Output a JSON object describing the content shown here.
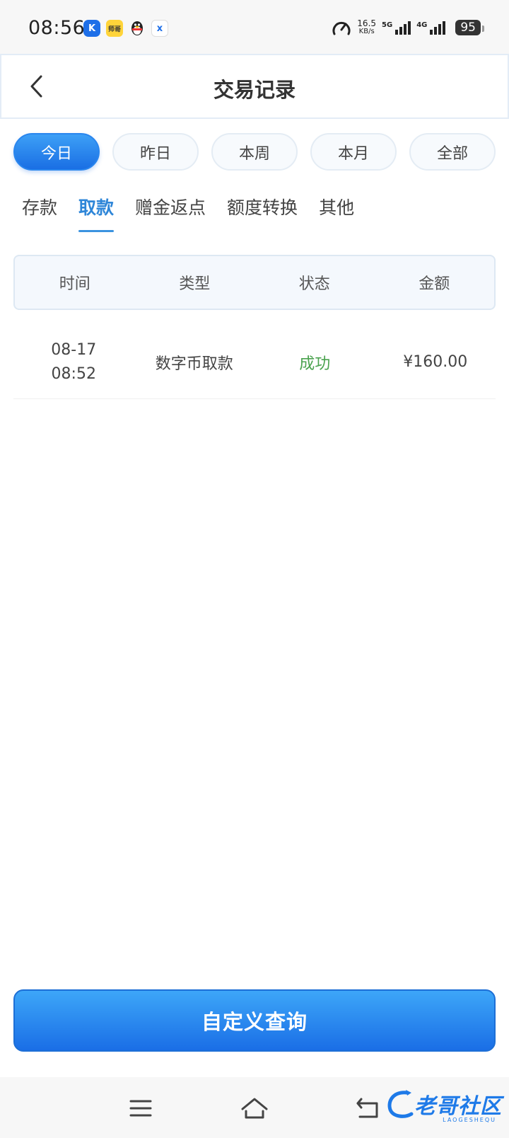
{
  "status_bar": {
    "time": "08:56",
    "apps": [
      {
        "name": "k-app-icon",
        "glyph": "K"
      },
      {
        "name": "yellow-app-icon",
        "glyph": "师哥"
      },
      {
        "name": "qq-icon",
        "glyph": ""
      },
      {
        "name": "x-app-icon",
        "glyph": "x"
      }
    ],
    "speed_value": "16.5",
    "speed_unit": "KB/s",
    "net1": "5G",
    "net2": "4G",
    "battery": "95"
  },
  "header": {
    "title": "交易记录",
    "back_icon": "chevron-left-icon"
  },
  "periods": [
    {
      "label": "今日",
      "active": true
    },
    {
      "label": "昨日",
      "active": false
    },
    {
      "label": "本周",
      "active": false
    },
    {
      "label": "本月",
      "active": false
    },
    {
      "label": "全部",
      "active": false
    }
  ],
  "tabs": [
    {
      "label": "存款",
      "active": false
    },
    {
      "label": "取款",
      "active": true
    },
    {
      "label": "赠金返点",
      "active": false
    },
    {
      "label": "额度转换",
      "active": false
    },
    {
      "label": "其他",
      "active": false
    }
  ],
  "table": {
    "columns": [
      "时间",
      "类型",
      "状态",
      "金额"
    ],
    "rows": [
      {
        "date": "08-17",
        "time": "08:52",
        "type": "数字币取款",
        "status": "成功",
        "amount": "¥160.00"
      }
    ]
  },
  "query_button": {
    "label": "自定义查询"
  },
  "nav_bar": {
    "menu_icon": "menu-icon",
    "home_icon": "home-icon",
    "back_icon": "back-icon"
  },
  "watermark": {
    "text": "老哥社区",
    "sub": "LAOGESHEQU"
  },
  "colors": {
    "accent": "#1a6fe4",
    "tab_active": "#2e86d8",
    "success": "#4aa24e"
  }
}
